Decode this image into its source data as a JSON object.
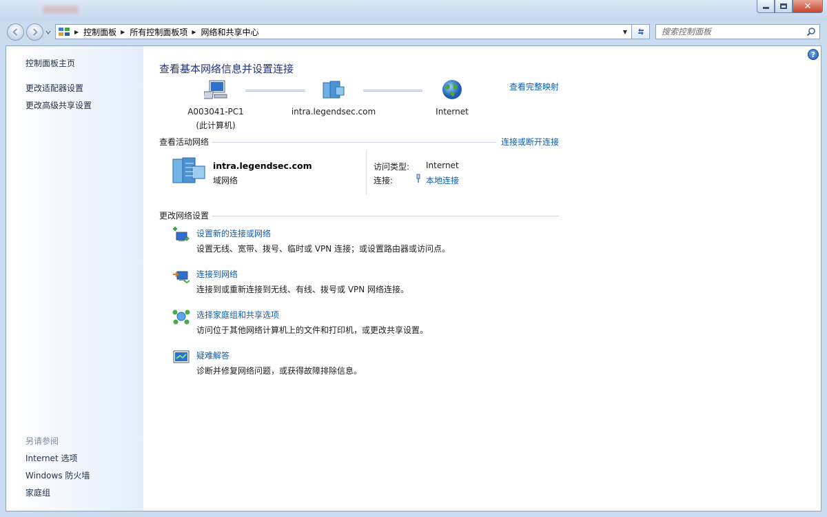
{
  "window": {
    "title_text": ""
  },
  "address": {
    "crumbs": [
      "控制面板",
      "所有控制面板项",
      "网络和共享中心"
    ]
  },
  "search": {
    "placeholder": "搜索控制面板"
  },
  "sidebar": {
    "home": "控制面板主页",
    "items": [
      "更改适配器设置",
      "更改高级共享设置"
    ],
    "see_also_title": "另请参阅",
    "see_also": [
      "Internet 选项",
      "Windows 防火墙",
      "家庭组"
    ]
  },
  "main": {
    "title": "查看基本网络信息并设置连接",
    "view_full_map": "查看完整映射",
    "map": {
      "computer_name": "A003041-PC1",
      "computer_sub": "(此计算机)",
      "network_name": "intra.legendsec.com",
      "internet_label": "Internet"
    },
    "active": {
      "heading": "查看活动网络",
      "connect_link": "连接或断开连接",
      "network_name": "intra.legendsec.com",
      "network_type": "域网络",
      "access_label": "访问类型:",
      "access_value": "Internet",
      "connection_label": "连接:",
      "connection_value": "本地连接"
    },
    "change": {
      "heading": "更改网络设置",
      "tasks": [
        {
          "link": "设置新的连接或网络",
          "desc": "设置无线、宽带、拨号、临时或 VPN 连接；或设置路由器或访问点。"
        },
        {
          "link": "连接到网络",
          "desc": "连接到或重新连接到无线、有线、拨号或 VPN 网络连接。"
        },
        {
          "link": "选择家庭组和共享选项",
          "desc": "访问位于其他网络计算机上的文件和打印机，或更改共享设置。"
        },
        {
          "link": "疑难解答",
          "desc": "诊断并修复网络问题，或获得故障排除信息。"
        }
      ]
    }
  }
}
